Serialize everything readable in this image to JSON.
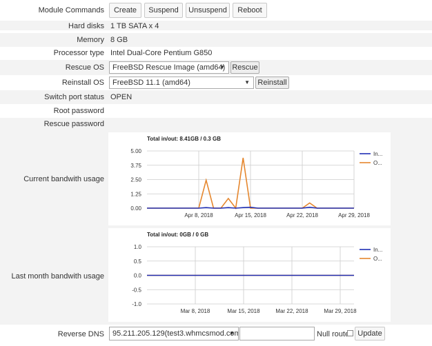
{
  "module_commands": {
    "label": "Module Commands",
    "buttons": [
      "Create",
      "Suspend",
      "Unsuspend",
      "Reboot"
    ]
  },
  "fields": {
    "hard_disks": {
      "label": "Hard disks",
      "value": "1 TB SATA x 4"
    },
    "memory": {
      "label": "Memory",
      "value": "8 GB"
    },
    "processor": {
      "label": "Processor type",
      "value": "Intel Dual-Core Pentium G850"
    },
    "rescue_os": {
      "label": "Rescue OS",
      "selected": "FreeBSD Rescue Image (amd64)",
      "button": "Rescue"
    },
    "reinstall_os": {
      "label": "Reinstall OS",
      "selected": "FreeBSD 11.1 (amd64)",
      "button": "Reinstall"
    },
    "switch_port": {
      "label": "Switch port status",
      "value": "OPEN"
    },
    "root_password": {
      "label": "Root password",
      "value": ""
    },
    "rescue_password": {
      "label": "Rescue password",
      "value": ""
    }
  },
  "current_bandwidth": {
    "label": "Current bandwith usage"
  },
  "last_month_bandwidth": {
    "label": "Last month bandwith usage"
  },
  "reverse_dns": {
    "label": "Reverse DNS",
    "selected": "95.211.205.129(test3.whmcsmod.com)",
    "input_value": "",
    "null_route_label": "Null route",
    "update_button": "Update"
  },
  "colors": {
    "in": "#1f2fb5",
    "out": "#e5862d"
  },
  "chart_data": [
    {
      "type": "line",
      "title": "Total in/out: 8.41GB / 0.3 GB",
      "xlabel": "",
      "ylabel": "",
      "ylim": [
        0,
        5
      ],
      "yticks": [
        "5.00",
        "3.75",
        "2.50",
        "1.25",
        "0.00"
      ],
      "xticks": [
        "Apr 8, 2018",
        "Apr 15, 2018",
        "Apr 22, 2018",
        "Apr 29, 2018"
      ],
      "legend": "top-right",
      "series": [
        {
          "name": "In...",
          "x": [
            "2018-04-01",
            "2018-04-08",
            "2018-04-09",
            "2018-04-10",
            "2018-04-11",
            "2018-04-12",
            "2018-04-13",
            "2018-04-14",
            "2018-04-15",
            "2018-04-16",
            "2018-04-17",
            "2018-04-22",
            "2018-04-23",
            "2018-04-24",
            "2018-04-25",
            "2018-04-29"
          ],
          "values": [
            0,
            0,
            0.05,
            0,
            0,
            0.05,
            0,
            0.05,
            0.08,
            0,
            0,
            0,
            0.08,
            0,
            0,
            0
          ]
        },
        {
          "name": "O...",
          "x": [
            "2018-04-01",
            "2018-04-08",
            "2018-04-09",
            "2018-04-10",
            "2018-04-11",
            "2018-04-12",
            "2018-04-13",
            "2018-04-14",
            "2018-04-15",
            "2018-04-16",
            "2018-04-17",
            "2018-04-22",
            "2018-04-23",
            "2018-04-24",
            "2018-04-25",
            "2018-04-29"
          ],
          "values": [
            0,
            0,
            2.45,
            0,
            0,
            0.85,
            0,
            4.4,
            0,
            0,
            0,
            0,
            0.45,
            0,
            0,
            0
          ]
        }
      ]
    },
    {
      "type": "line",
      "title": "Total in/out: 0GB / 0 GB",
      "xlabel": "",
      "ylabel": "",
      "ylim": [
        -1,
        1
      ],
      "yticks": [
        "1.0",
        "0.5",
        "0.0",
        "-0.5",
        "-1.0"
      ],
      "xticks": [
        "Mar 8, 2018",
        "Mar 15, 2018",
        "Mar 22, 2018",
        "Mar 29, 2018"
      ],
      "legend": "top-right",
      "series": [
        {
          "name": "In...",
          "x": [
            "2018-03-01",
            "2018-03-31"
          ],
          "values": [
            0,
            0
          ]
        },
        {
          "name": "O...",
          "x": [
            "2018-03-01",
            "2018-03-31"
          ],
          "values": [
            0,
            0
          ]
        }
      ]
    }
  ]
}
